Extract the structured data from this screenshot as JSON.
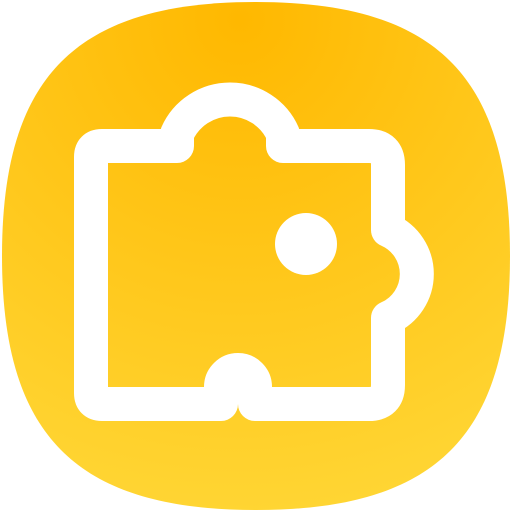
{
  "icon": {
    "name": "puzzle-piece-icon",
    "shape": "squircle",
    "colors": {
      "background_top": "#FFB800",
      "background_bottom": "#FFD93A",
      "glyph": "#FFFFFF"
    }
  }
}
